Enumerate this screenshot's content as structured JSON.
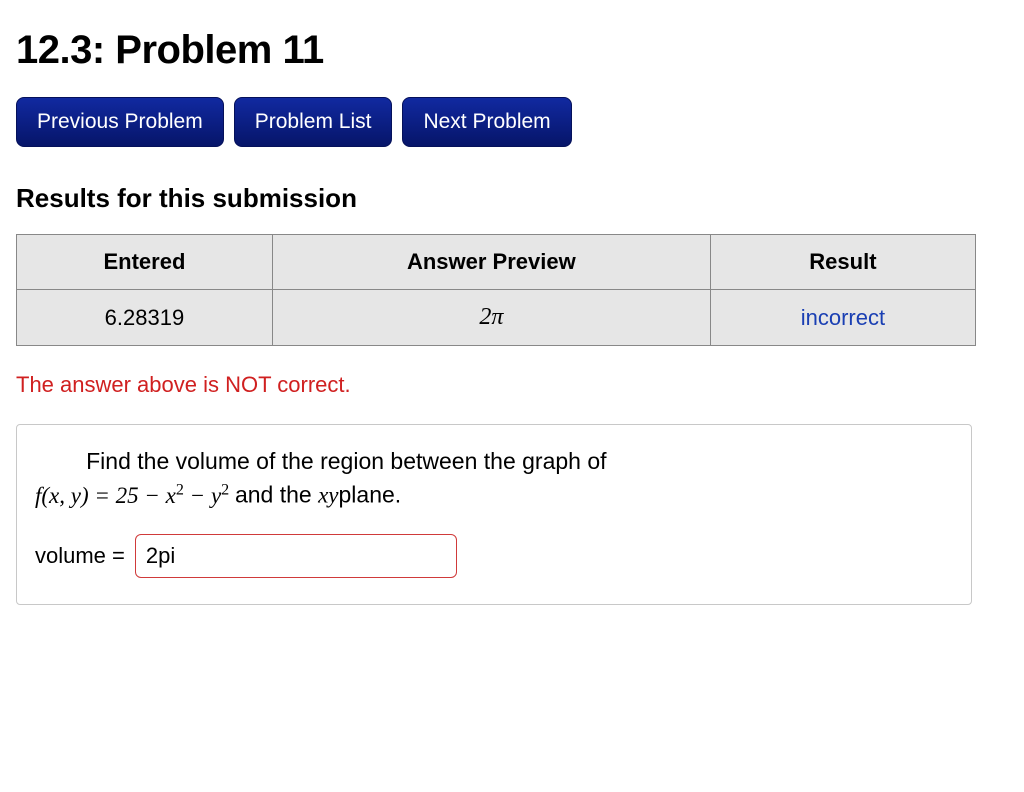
{
  "page": {
    "title": "12.3: Problem 11"
  },
  "nav": {
    "previous": "Previous Problem",
    "list": "Problem List",
    "next": "Next Problem"
  },
  "results": {
    "heading": "Results for this submission",
    "headers": {
      "entered": "Entered",
      "preview": "Answer Preview",
      "result": "Result"
    },
    "row": {
      "entered": "6.28319",
      "preview": "2π",
      "result": "incorrect"
    },
    "feedback": "The answer above is NOT correct."
  },
  "problem": {
    "intro": "Find the volume of the region between the graph of",
    "func_lhs": "f(x, y) = 25 − x",
    "sq1": "2",
    "minus_y": " − y",
    "sq2": "2",
    "tail": "  and the ",
    "xy": "xy",
    "plane": "plane.",
    "answer_label": "volume =",
    "answer_value": "2pi"
  }
}
